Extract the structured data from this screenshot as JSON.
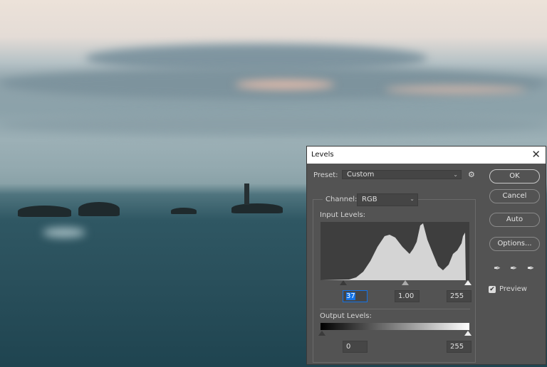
{
  "dialog": {
    "title": "Levels",
    "close_icon": "close-icon",
    "preset": {
      "label": "Preset:",
      "value": "Custom"
    },
    "channel": {
      "label": "Channel:",
      "value": "RGB"
    },
    "input_levels": {
      "label": "Input Levels:",
      "black": "37",
      "gamma": "1.00",
      "white": "255"
    },
    "output_levels": {
      "label": "Output Levels:",
      "black": "0",
      "white": "255"
    },
    "buttons": {
      "ok": "OK",
      "cancel": "Cancel",
      "auto": "Auto",
      "options": "Options..."
    },
    "eyedroppers": [
      "black-eyedropper-icon",
      "gray-eyedropper-icon",
      "white-eyedropper-icon"
    ],
    "preview": {
      "label": "Preview",
      "checked": true
    },
    "accent": "#1473e6"
  }
}
